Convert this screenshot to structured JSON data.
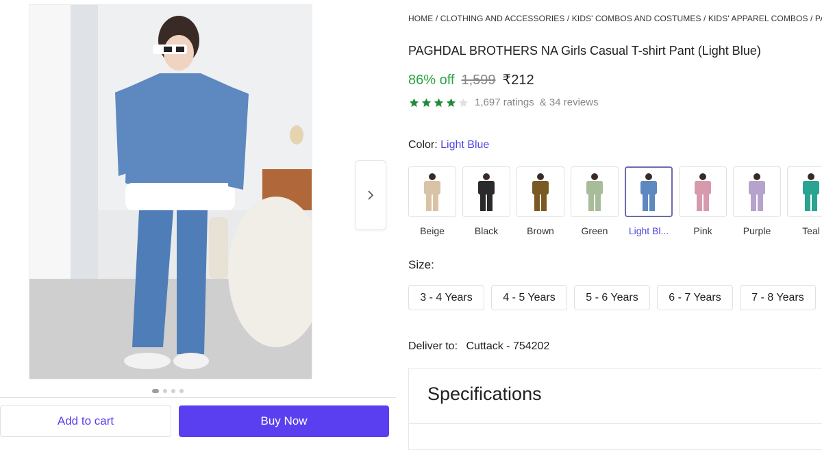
{
  "gallery": {
    "main_image_alt": "Girl wearing light blue t-shirt and pants with sunglasses",
    "dots_count": 4,
    "active_dot": 0
  },
  "actions": {
    "add_to_cart": "Add to cart",
    "buy_now": "Buy Now"
  },
  "breadcrumb": "HOME / CLOTHING AND ACCESSORIES / KIDS' COMBOS AND COSTUMES / KIDS' APPAREL COMBOS / PAGHDAL",
  "product": {
    "title": "PAGHDAL BROTHERS NA Girls Casual T-shirt Pant (Light Blue)",
    "discount": "86% off",
    "mrp": "1,599",
    "price": "₹212",
    "rating_stars": 4,
    "ratings": "1,697 ratings",
    "reviews": "& 34 reviews"
  },
  "color": {
    "label": "Color:",
    "selected": "Light Blue",
    "options": [
      {
        "label": "Beige",
        "hex": "#d9c3a7"
      },
      {
        "label": "Black",
        "hex": "#2a2a2a"
      },
      {
        "label": "Brown",
        "hex": "#7a5a22"
      },
      {
        "label": "Green",
        "hex": "#a9bc9a"
      },
      {
        "label": "Light Bl...",
        "hex": "#5d88c0"
      },
      {
        "label": "Pink",
        "hex": "#d69aac"
      },
      {
        "label": "Purple",
        "hex": "#b6a3cc"
      },
      {
        "label": "Teal",
        "hex": "#2aa392"
      }
    ]
  },
  "size": {
    "label": "Size:",
    "options": [
      "3 - 4 Years",
      "4 - 5 Years",
      "5 - 6 Years",
      "6 - 7 Years",
      "7 - 8 Years"
    ]
  },
  "delivery": {
    "label": "Deliver to:",
    "location": "Cuttack - 754202"
  },
  "specifications": {
    "title": "Specifications"
  },
  "colors": {
    "accent": "#5a3ff0",
    "discount": "#26a541",
    "star": "#1f8a3b"
  }
}
